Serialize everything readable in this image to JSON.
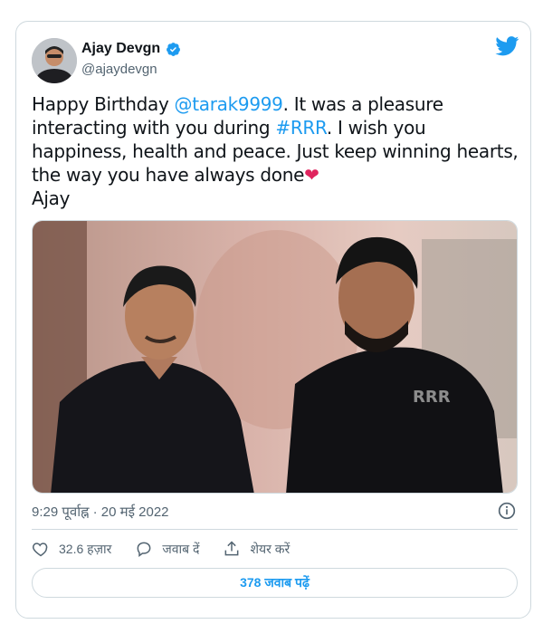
{
  "author": {
    "name": "Ajay Devgn",
    "handle": "@ajaydevgn",
    "verified": true
  },
  "tweet": {
    "text_part1": "Happy Birthday ",
    "mention": "@tarak9999",
    "text_part2": ". It was a pleasure interacting with you during ",
    "hashtag": "#RRR",
    "text_part3": ". I wish you happiness, health and peace. Just keep winning hearts, the way you have always done",
    "heart": "❤",
    "signature": "Ajay"
  },
  "meta": {
    "time": "9:29 पूर्वाह्न",
    "separator": " · ",
    "date": "20 मई 2022"
  },
  "actions": {
    "likes": "32.6 हज़ार",
    "reply_label": "जवाब दें",
    "share_label": "शेयर करें"
  },
  "replies_button": "378 जवाब पढ़ें",
  "colors": {
    "accent": "#1d9bf0",
    "text": "#0f1419",
    "muted": "#536471",
    "heart": "#e0245e",
    "border": "#cfd9de"
  },
  "icons": [
    "avatar",
    "verified-badge-icon",
    "twitter-bird-icon",
    "info-icon",
    "heart-icon",
    "reply-icon",
    "share-icon"
  ]
}
